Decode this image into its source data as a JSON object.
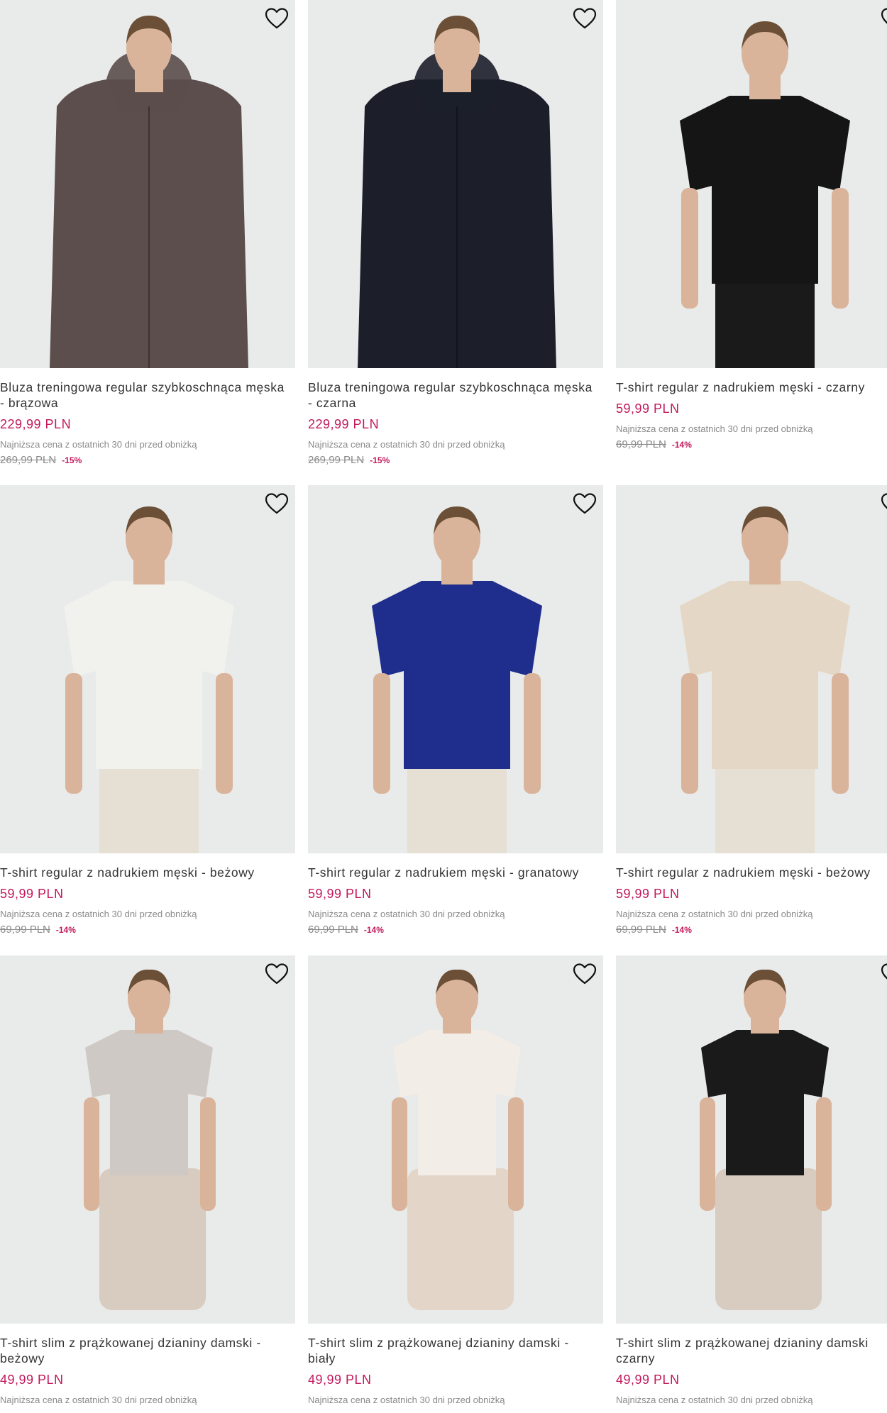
{
  "colors": {
    "price": "#c2185b",
    "discount": "#c2185b",
    "image_bg": "#e9eaea",
    "text": "#333333",
    "muted": "#8a8a8a"
  },
  "icons": {
    "wishlist": "heart-outline-icon"
  },
  "products": [
    {
      "title": "Bluza treningowa regular szybkoschnąca męska - brązowa",
      "price": "229,99 PLN",
      "lowest_label": "Najniższa cena z ostatnich 30 dni przed obniżką",
      "old_price": "269,99 PLN",
      "discount": "-15%",
      "garment_color": "#5b4e4c",
      "garment_type": "hoodie"
    },
    {
      "title": "Bluza treningowa regular szybkoschnąca męska - czarna",
      "price": "229,99 PLN",
      "lowest_label": "Najniższa cena z ostatnich 30 dni przed obniżką",
      "old_price": "269,99 PLN",
      "discount": "-15%",
      "garment_color": "#1c1f2a",
      "garment_type": "hoodie"
    },
    {
      "title": "T-shirt regular z nadrukiem męski - czarny",
      "price": "59,99 PLN",
      "lowest_label": "Najniższa cena z ostatnich 30 dni przed obniżką",
      "old_price": "69,99 PLN",
      "discount": "-14%",
      "garment_color": "#151515",
      "garment_type": "tshirt"
    },
    {
      "title": "T-shirt regular z nadrukiem męski - beżowy",
      "price": "59,99 PLN",
      "lowest_label": "Najniższa cena z ostatnich 30 dni przed obniżką",
      "old_price": "69,99 PLN",
      "discount": "-14%",
      "garment_color": "#f1f2ee",
      "garment_type": "tshirt"
    },
    {
      "title": "T-shirt regular z nadrukiem męski - granatowy",
      "price": "59,99 PLN",
      "lowest_label": "Najniższa cena z ostatnich 30 dni przed obniżką",
      "old_price": "69,99 PLN",
      "discount": "-14%",
      "garment_color": "#1f2e8c",
      "garment_type": "tshirt"
    },
    {
      "title": "T-shirt regular z nadrukiem męski - beżowy",
      "price": "59,99 PLN",
      "lowest_label": "Najniższa cena z ostatnich 30 dni przed obniżką",
      "old_price": "69,99 PLN",
      "discount": "-14%",
      "garment_color": "#e5d7c5",
      "garment_type": "tshirt"
    },
    {
      "title": "T-shirt slim z prążkowanej dzianiny damski - beżowy",
      "price": "49,99 PLN",
      "lowest_label": "Najniższa cena z ostatnich 30 dni przed obniżką",
      "garment_color": "#cfc9c5",
      "garment_type": "women"
    },
    {
      "title": "T-shirt slim z prążkowanej dzianiny damski - biały",
      "price": "49,99 PLN",
      "lowest_label": "Najniższa cena z ostatnich 30 dni przed obniżką",
      "garment_color": "#f2ede6",
      "garment_type": "women"
    },
    {
      "title": "T-shirt slim z prążkowanej dzianiny damski czarny",
      "price": "49,99 PLN",
      "lowest_label": "Najniższa cena z ostatnich 30 dni przed obniżką",
      "garment_color": "#1a1a1a",
      "garment_type": "women"
    }
  ]
}
